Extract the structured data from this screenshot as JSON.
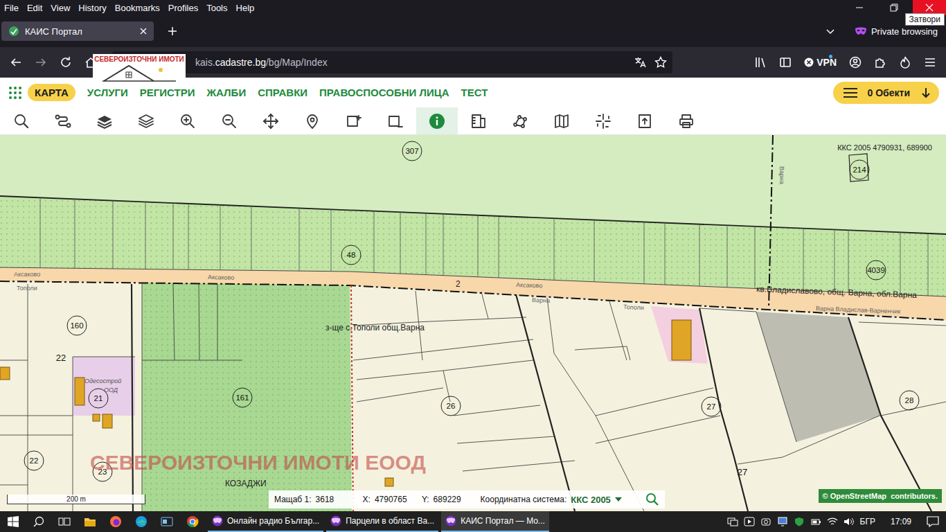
{
  "window": {
    "close_tooltip": "Затвори"
  },
  "menu": [
    "File",
    "Edit",
    "View",
    "History",
    "Bookmarks",
    "Profiles",
    "Tools",
    "Help"
  ],
  "tabs": [
    {
      "label": "КАИС Портал",
      "selected": true
    }
  ],
  "private_browsing": "Private browsing",
  "address": {
    "subdomain": "kais.",
    "domain": "cadastre.bg",
    "path": "/bg/Map/Index"
  },
  "vpn": "VPN",
  "logo_overlay": {
    "title": "СЕВЕРОИЗТОЧНИ ИМОТИ"
  },
  "app_nav": [
    {
      "label": "КАРТА",
      "selected": true
    },
    {
      "label": "УСЛУГИ",
      "selected": false
    },
    {
      "label": "РЕГИСТРИ",
      "selected": false
    },
    {
      "label": "ЖАЛБИ",
      "selected": false
    },
    {
      "label": "СПРАВКИ",
      "selected": false
    },
    {
      "label": "ПРАВОСПОСОБНИ ЛИЦА",
      "selected": false
    },
    {
      "label": "ТЕСТ",
      "selected": false
    }
  ],
  "objects": {
    "label": "0 Обекти"
  },
  "tools": [
    {
      "selected": false
    },
    {
      "selected": false
    },
    {
      "selected": false
    },
    {
      "selected": false
    },
    {
      "selected": false
    },
    {
      "selected": false
    },
    {
      "selected": false
    },
    {
      "selected": false
    },
    {
      "selected": false
    },
    {
      "selected": false
    },
    {
      "selected": true
    },
    {
      "selected": false
    },
    {
      "selected": false
    },
    {
      "selected": false
    },
    {
      "selected": false
    },
    {
      "selected": false
    },
    {
      "selected": false
    }
  ],
  "map": {
    "coords": "ККС 2005 4790931, 689900",
    "parcels": [
      {
        "number": "307",
        "kind": "circle"
      },
      {
        "number": "214",
        "kind": "circle"
      },
      {
        "number": "48",
        "kind": "circle"
      },
      {
        "number": "4039",
        "kind": "circle"
      },
      {
        "number": "160",
        "kind": "circle"
      },
      {
        "number": "22",
        "kind": "plain"
      },
      {
        "number": "21",
        "kind": "circle"
      },
      {
        "number": "161",
        "kind": "circle"
      },
      {
        "number": "26",
        "kind": "circle"
      },
      {
        "number": "27",
        "kind": "circle"
      },
      {
        "number": "28",
        "kind": "circle"
      },
      {
        "number": "22",
        "kind": "circle"
      },
      {
        "number": "23",
        "kind": "circle"
      },
      {
        "number": "27",
        "kind": "plain"
      }
    ],
    "labels": [
      {
        "text": "Аксаково",
        "kind": "road"
      },
      {
        "text": "Тополи",
        "kind": "road"
      },
      {
        "text": "Аксаково",
        "kind": "road"
      },
      {
        "text": "2",
        "kind": "area"
      },
      {
        "text": "Аксаково",
        "kind": "road"
      },
      {
        "text": "Варна",
        "kind": "road"
      },
      {
        "text": "Тополи",
        "kind": "road"
      },
      {
        "text": "кв.Владиславово, общ. Варна, обл.Варна",
        "kind": "area"
      },
      {
        "text": "Варна",
        "kind": "road"
      },
      {
        "text": "Варна Владислав-Варненчик",
        "kind": "road"
      },
      {
        "text": "з-ще с.Тополи общ.Варна",
        "kind": "area"
      },
      {
        "text": "Одесострой",
        "kind": "note"
      },
      {
        "text": "ООД",
        "kind": "note"
      },
      {
        "text": "КОЗАДЖИ",
        "kind": "area"
      }
    ],
    "watermark": "СЕВЕРОИЗТОЧНИ ИМОТИ ЕООД",
    "scale": "200 m",
    "attribution": "© OpenStreetMap  contributors."
  },
  "status": {
    "scale_label": "Мащаб 1:",
    "scale": "3618",
    "x_label": "X:",
    "x": "4790765",
    "y_label": "Y:",
    "y": "689229",
    "crs_label": "Координатна система:",
    "crs": "ККС 2005"
  },
  "taskbar": {
    "items": [
      {
        "label": "Онлайн радио Българ...",
        "selected": false
      },
      {
        "label": "Парцели в област Ва...",
        "selected": false
      },
      {
        "label": "КАИС Портал — Mo...",
        "selected": true
      }
    ],
    "lang": "БГР",
    "time": "17:09"
  }
}
